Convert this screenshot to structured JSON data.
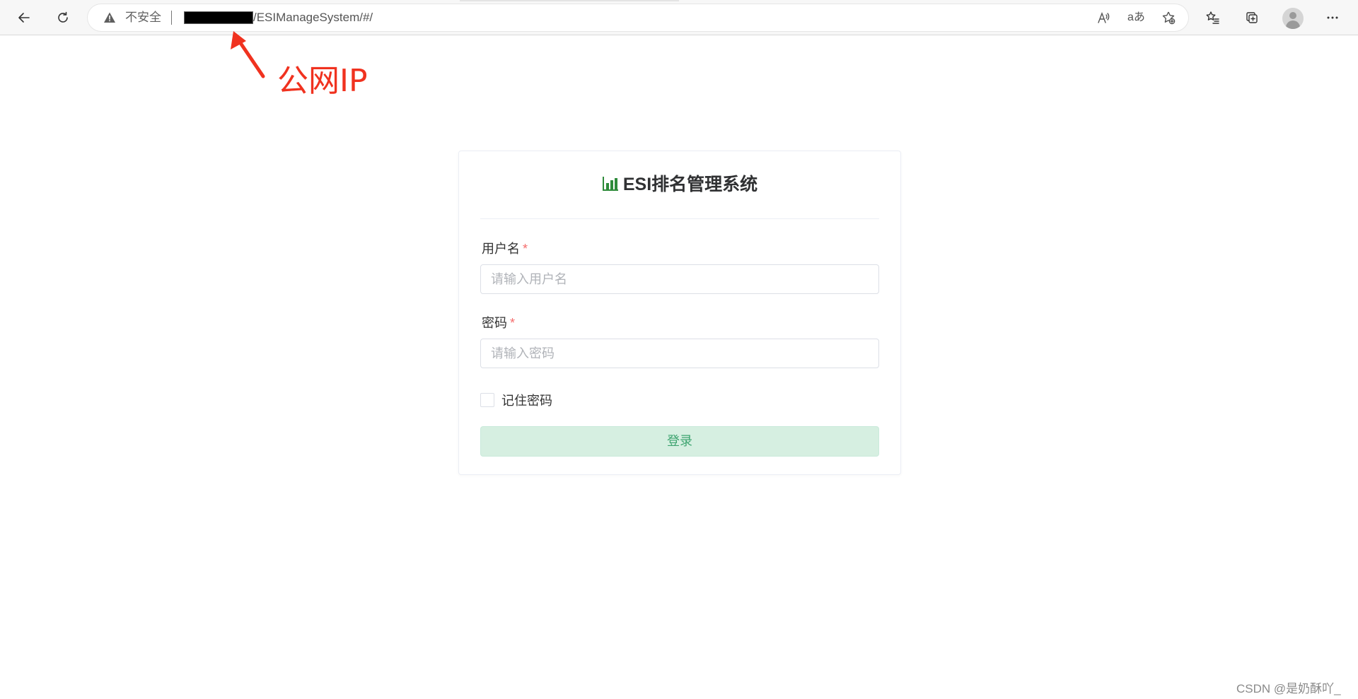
{
  "browser": {
    "security_label": "不安全",
    "url_path": "/ESIManageSystem/#/",
    "icons": {
      "back": "back-arrow-icon",
      "refresh": "refresh-icon",
      "warning": "warning-triangle-icon",
      "read_aloud": "read-aloud-icon",
      "translate": "translate-icon",
      "add_favorite": "star-plus-icon",
      "favorites": "favorites-list-icon",
      "collections": "collections-icon",
      "profile": "profile-avatar-icon",
      "more": "more-dots-icon"
    },
    "translate_glyph": "aあ"
  },
  "annotation": {
    "text": "公网IP",
    "color": "#f0321f"
  },
  "login": {
    "title": "ESI排名管理系统",
    "title_icon": "bar-chart-icon",
    "title_icon_color": "#2e8b3a",
    "username": {
      "label": "用户名",
      "required_mark": "*",
      "placeholder": "请输入用户名",
      "value": ""
    },
    "password": {
      "label": "密码",
      "required_mark": "*",
      "placeholder": "请输入密码",
      "value": ""
    },
    "remember": {
      "label": "记住密码",
      "checked": false
    },
    "submit_label": "登录",
    "submit_color": "#3ea470"
  },
  "watermark": "CSDN @是奶酥吖_"
}
